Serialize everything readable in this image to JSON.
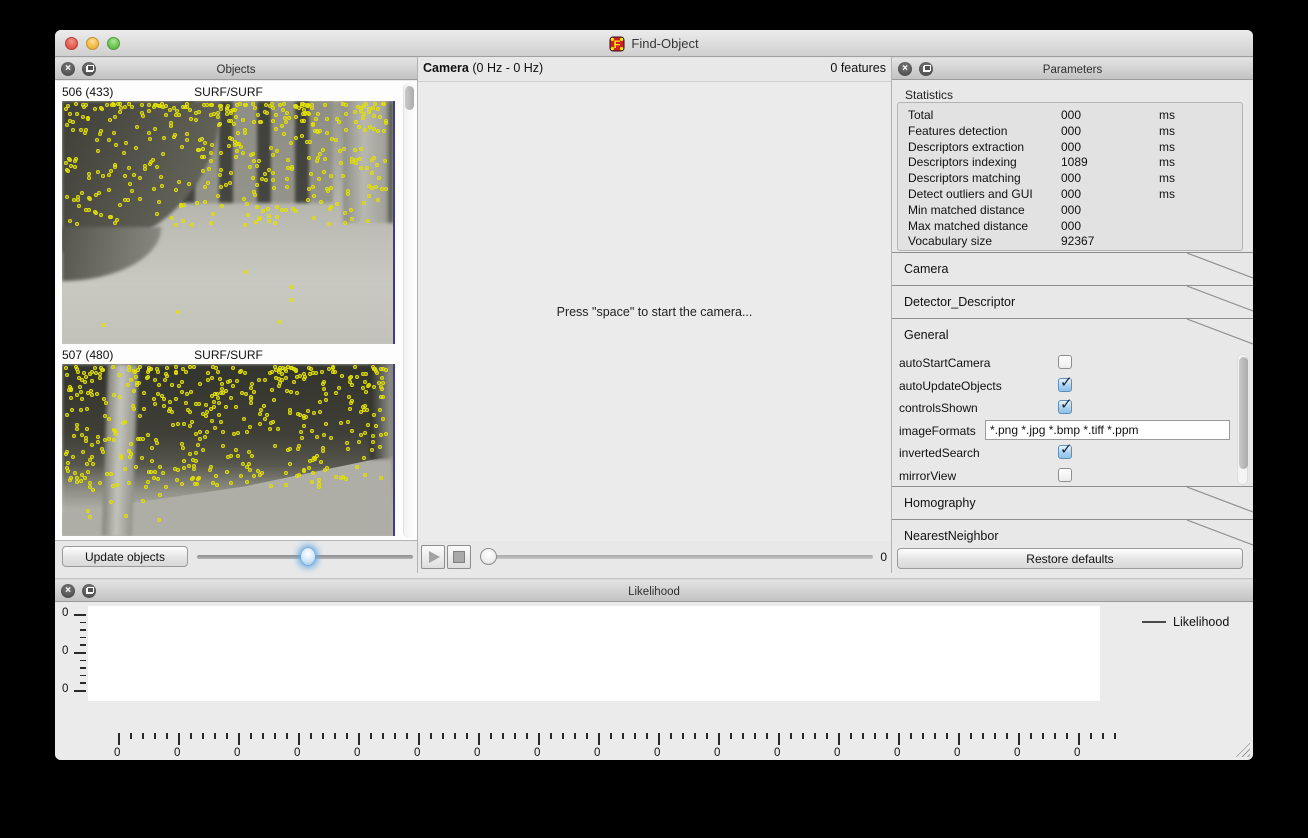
{
  "window": {
    "title": "Find-Object"
  },
  "objects_panel": {
    "title": "Objects",
    "items": [
      {
        "id": "506 (433)",
        "detector": "SURF/SURF",
        "feature_count": 433,
        "seed": 12345,
        "y_power": 1.9,
        "y_max": 50,
        "strays": 6
      },
      {
        "id": "507 (480)",
        "detector": "SURF/SURF",
        "feature_count": 480,
        "seed": 67890,
        "y_power": 1.5,
        "y_max": 70,
        "strays": 20
      }
    ],
    "update_button": "Update objects"
  },
  "camera_panel": {
    "title": "Camera",
    "rate": "(0 Hz - 0 Hz)",
    "features": "0 features",
    "message": "Press \"space\" to start the camera...",
    "frame_value": "0"
  },
  "parameters_panel": {
    "title": "Parameters",
    "statistics": {
      "label": "Statistics",
      "rows": [
        {
          "name": "Total",
          "value": "000",
          "unit": "ms"
        },
        {
          "name": "Features detection",
          "value": "000",
          "unit": "ms"
        },
        {
          "name": "Descriptors extraction",
          "value": "000",
          "unit": "ms"
        },
        {
          "name": "Descriptors indexing",
          "value": "1089",
          "unit": "ms"
        },
        {
          "name": "Descriptors matching",
          "value": "000",
          "unit": "ms"
        },
        {
          "name": "Detect outliers and GUI",
          "value": "000",
          "unit": "ms"
        },
        {
          "name": "Min matched distance",
          "value": "000",
          "unit": ""
        },
        {
          "name": "Max matched distance",
          "value": "000",
          "unit": ""
        },
        {
          "name": "Vocabulary size",
          "value": "92367",
          "unit": ""
        }
      ]
    },
    "sections": [
      {
        "label": "Camera"
      },
      {
        "label": "Detector_Descriptor"
      },
      {
        "label": "General"
      },
      {
        "label": "Homography"
      },
      {
        "label": "NearestNeighbor"
      }
    ],
    "general_params": [
      {
        "name": "autoStartCamera",
        "type": "checkbox",
        "checked": false
      },
      {
        "name": "autoUpdateObjects",
        "type": "checkbox",
        "checked": true
      },
      {
        "name": "controlsShown",
        "type": "checkbox",
        "checked": true
      },
      {
        "name": "imageFormats",
        "type": "text",
        "value": "*.png *.jpg *.bmp *.tiff *.ppm"
      },
      {
        "name": "invertedSearch",
        "type": "checkbox",
        "checked": true
      },
      {
        "name": "mirrorView",
        "type": "checkbox",
        "checked": false
      }
    ],
    "restore_button": "Restore defaults"
  },
  "likelihood_panel": {
    "title": "Likelihood",
    "legend": "Likelihood"
  },
  "chart_data": {
    "type": "line",
    "title": "Likelihood",
    "series": [
      {
        "name": "Likelihood",
        "color": "#4a4a4a",
        "values": []
      }
    ],
    "x_tick_labels": [
      "0",
      "0",
      "0",
      "0",
      "0",
      "0",
      "0",
      "0",
      "0",
      "0",
      "0",
      "0",
      "0",
      "0",
      "0",
      "0",
      "0"
    ],
    "y_tick_labels": [
      "0",
      "0",
      "0"
    ],
    "grid": false,
    "legend_position": "right"
  },
  "colors": {
    "feature_dot": "#e2e200",
    "checkbox_checked": "#8ec2e8",
    "slider_glow": "#5ca6e6",
    "app_icon_bg": "#cc2222",
    "app_icon_fg": "#ffee00"
  }
}
